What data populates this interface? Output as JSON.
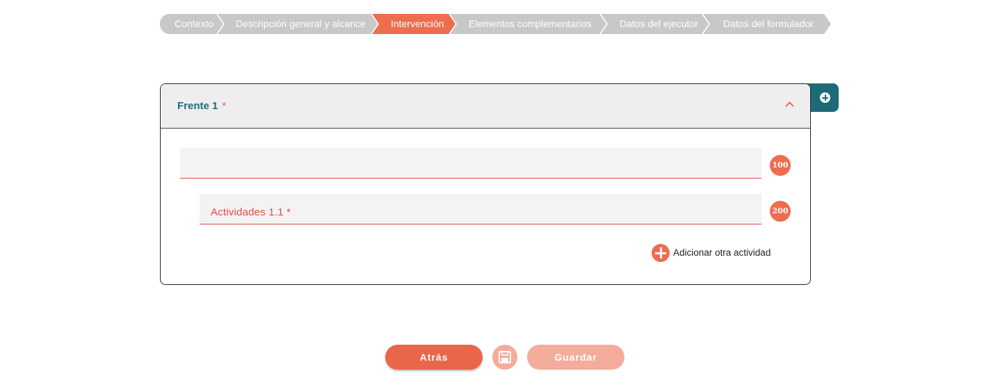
{
  "stepper": {
    "steps": [
      {
        "label": "Contexto",
        "active": false
      },
      {
        "label": "Descripción general y alcance",
        "active": false
      },
      {
        "label": "Intervención",
        "active": true
      },
      {
        "label": "Elementos complementarios",
        "active": false
      },
      {
        "label": "Datos del ejecutor",
        "active": false
      },
      {
        "label": "Datos del formulador",
        "active": false
      }
    ]
  },
  "panel": {
    "title": "Frente 1",
    "required_mark": "*",
    "field_1": {
      "value": "",
      "counter": "100"
    },
    "field_2": {
      "label": "Actividades 1.1 *",
      "counter": "200"
    },
    "add_activity_label": "Adicionar otra actividad"
  },
  "footer": {
    "back_label": "Atrás",
    "save_label": "Guardar"
  },
  "colors": {
    "accent": "#ee6d4f",
    "teal": "#1e6a78",
    "inactive_step": "#c8c8c8",
    "error": "#e24a44"
  },
  "icons": {
    "add_frente": "plus-circle-icon",
    "collapse": "chevron-up-icon",
    "add_activity": "plus-circle-icon",
    "save": "floppy-disk-icon"
  }
}
